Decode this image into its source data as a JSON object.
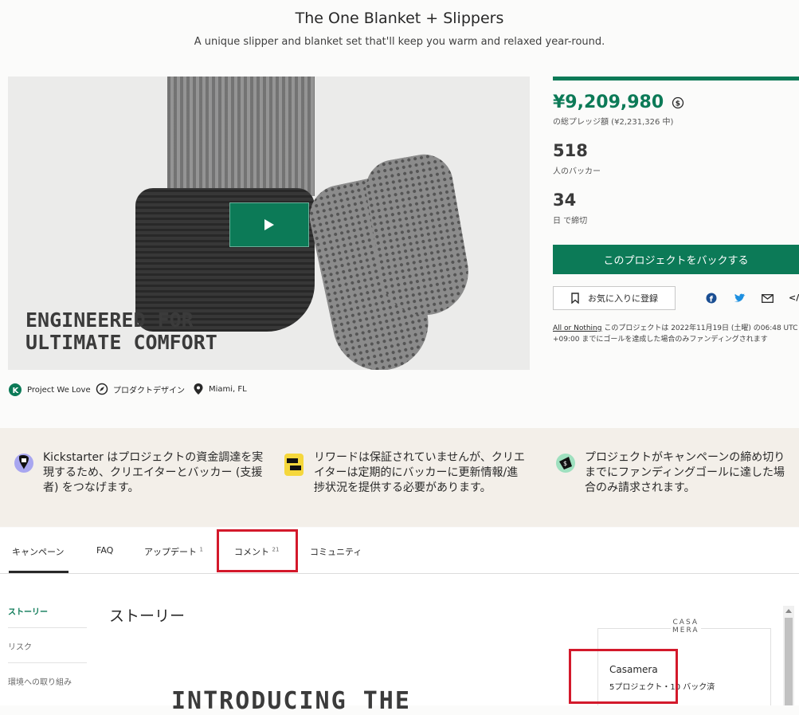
{
  "header": {
    "title": "The One Blanket + Slippers",
    "subtitle": "A unique slipper and blanket set that'll keep you warm and relaxed year-round."
  },
  "hero": {
    "caption": "ENGINEERED FOR\nULTIMATE COMFORT",
    "play_icon": "play-icon"
  },
  "tags": [
    {
      "label": "Project We Love",
      "icon": "kickstarter-icon"
    },
    {
      "label": "プロダクトデザイン",
      "icon": "compass-icon"
    },
    {
      "label": "Miami, FL",
      "icon": "location-pin-icon"
    }
  ],
  "funding": {
    "pledged": "¥9,209,980",
    "pledged_sub": "の総プレッジ額 (¥2,231,326 中)",
    "backers": "518",
    "backers_sub": "人のバッカー",
    "days": "34",
    "days_sub": "日 で締切",
    "back_label": "このプロジェクトをバックする",
    "remind_label": "お気に入りに登録",
    "aon_link": "All or Nothing",
    "aon_text": " このプロジェクトは 2022年11月19日 (土曜) の06:48 UTC +09:00 までにゴールを達成した場合のみファンディングされます",
    "progress": 1.0,
    "accent": "#0c7a57"
  },
  "info": [
    {
      "text": "Kickstarter はプロジェクトの資金調達を実現するため、クリエイターとバッカー (支援者) をつなげます。",
      "icon": "kickstarter-pin-icon"
    },
    {
      "text": "リワードは保証されていませんが、クリエイターは定期的にバッカーに更新情報/進捗状況を提供する必要があります。",
      "icon": "chat-bubble-icon"
    },
    {
      "text": "プロジェクトがキャンペーンの締め切りまでにファンディングゴールに達した場合のみ請求されます。",
      "icon": "money-bag-icon"
    }
  ],
  "tabs": [
    {
      "label": "キャンペーン",
      "count": ""
    },
    {
      "label": "FAQ",
      "count": ""
    },
    {
      "label": "アップデート",
      "count": "1"
    },
    {
      "label": "コメント",
      "count": "21"
    },
    {
      "label": "コミュニティ",
      "count": ""
    }
  ],
  "sidebar": {
    "items": [
      "ストーリー",
      "リスク",
      "環境への取り組み"
    ]
  },
  "story": {
    "heading": "ストーリー",
    "intro": "INTRODUCING THE"
  },
  "creator": {
    "logo": "CASA\nMERA",
    "name": "Casamera",
    "meta": "5プロジェクト・10 バック済"
  }
}
